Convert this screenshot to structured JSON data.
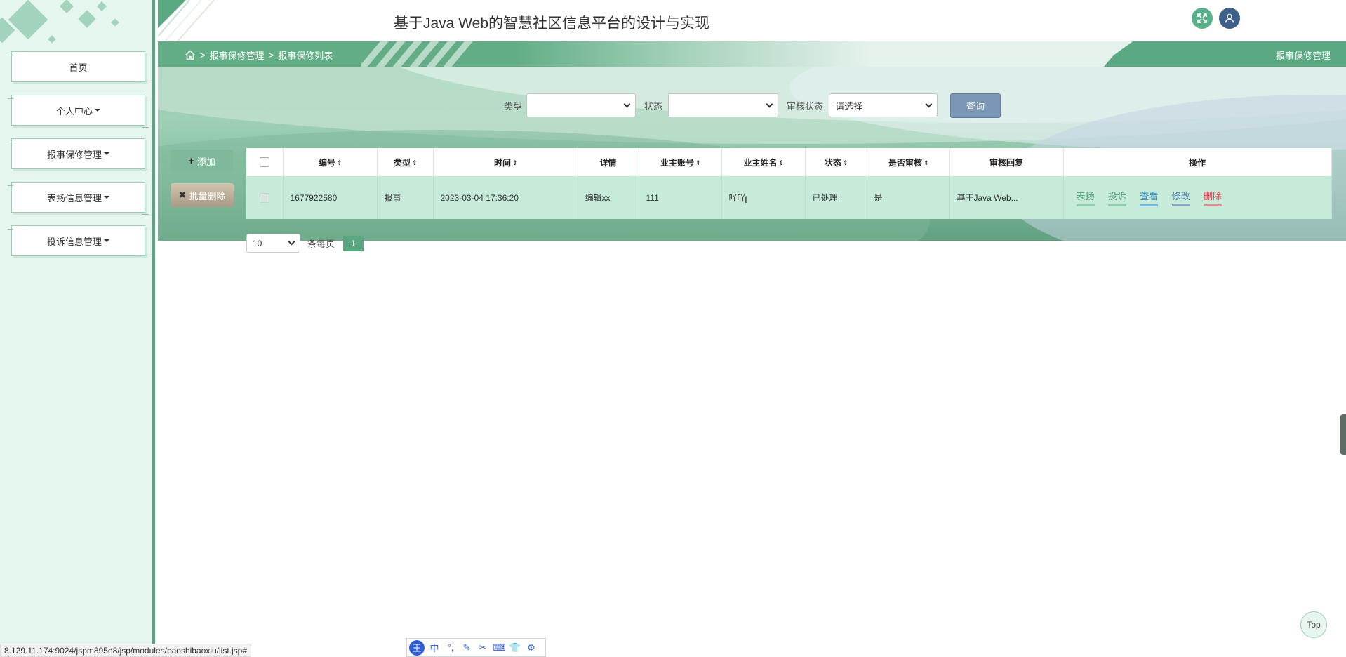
{
  "header": {
    "title": "基于Java Web的智慧社区信息平台的设计与实现"
  },
  "sidebar": {
    "items": [
      {
        "label": "首页",
        "dropdown": false
      },
      {
        "label": "个人中心",
        "dropdown": true
      },
      {
        "label": "报事保修管理",
        "dropdown": true
      },
      {
        "label": "表扬信息管理",
        "dropdown": true
      },
      {
        "label": "投诉信息管理",
        "dropdown": true
      }
    ]
  },
  "breadcrumb": {
    "level1": "报事保修管理",
    "level2": "报事保修列表",
    "separator": ">"
  },
  "right_tab": {
    "label": "报事保修管理"
  },
  "search": {
    "type_label": "类型",
    "type_value": "",
    "status_label": "状态",
    "status_value": "",
    "audit_label": "审核状态",
    "audit_value": "请选择",
    "query_button": "查询"
  },
  "actions": {
    "add_label": "添加",
    "add_icon": "+",
    "batch_delete_label": "批量删除",
    "batch_delete_icon": "✖"
  },
  "table": {
    "headers": [
      "编号",
      "类型",
      "时间",
      "详情",
      "业主账号",
      "业主姓名",
      "状态",
      "是否审核",
      "审核回复",
      "操作"
    ],
    "rows": [
      {
        "id": "1677922580",
        "type": "报事",
        "time": "2023-03-04 17:36:20",
        "detail": "编辑xx",
        "account": "111",
        "name": "吖吖",
        "status": "已处理",
        "audited": "是",
        "reply": "基于Java Web...",
        "ops": {
          "praise": "表扬",
          "complain": "投诉",
          "view": "查看",
          "edit": "修改",
          "delete": "删除"
        }
      }
    ]
  },
  "pagination": {
    "page_size": "10",
    "per_page_label": "条每页",
    "current_page": "1"
  },
  "status_bar": {
    "url": "8.129.11.174:9024/jspm895e8/jsp/modules/baoshibaoxiu/list.jsp#"
  },
  "ime": {
    "logo": "王",
    "lang": "中",
    "punct": "°,"
  },
  "top_button": {
    "label": "Top"
  },
  "colors": {
    "accent": "#5aa882",
    "query": "#7b97b6",
    "op_praise": "#4f9b74",
    "op_complain": "#4f9b74",
    "op_view": "#2f89c7",
    "op_edit": "#4f7aa8",
    "op_delete": "#e0424f"
  }
}
